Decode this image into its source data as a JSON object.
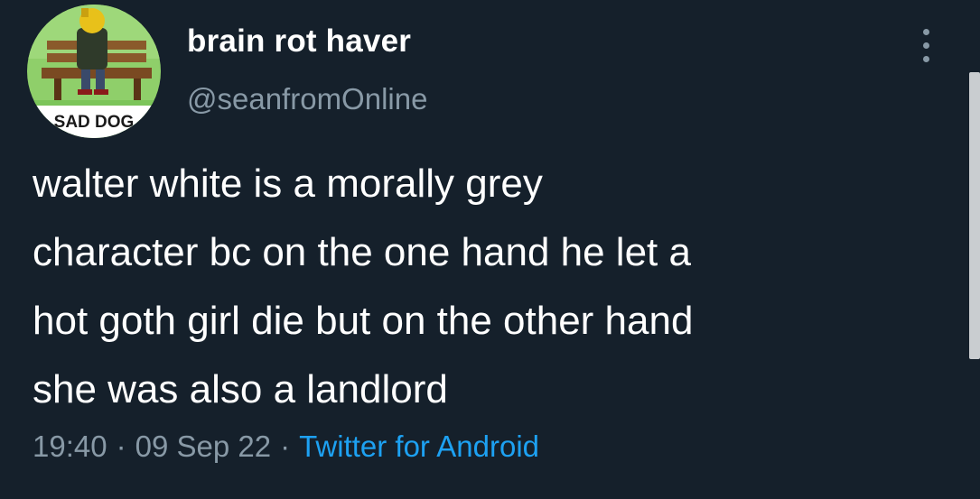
{
  "tweet": {
    "author": {
      "display_name": "brain rot haver",
      "handle": "@seanfromOnline",
      "avatar_caption": "SAD DOG"
    },
    "text": "walter white is a morally grey\ncharacter bc on the one hand he let a\nhot goth girl die but on the other hand\nshe was also a landlord",
    "time": "19:40",
    "date": "09 Sep 22",
    "separator": "·",
    "source": "Twitter for Android"
  },
  "colors": {
    "background": "#15202b",
    "primary_text": "#ffffff",
    "secondary_text": "#8899a6",
    "link": "#1da1f2"
  },
  "icons": {
    "more": "more-vertical-icon"
  }
}
